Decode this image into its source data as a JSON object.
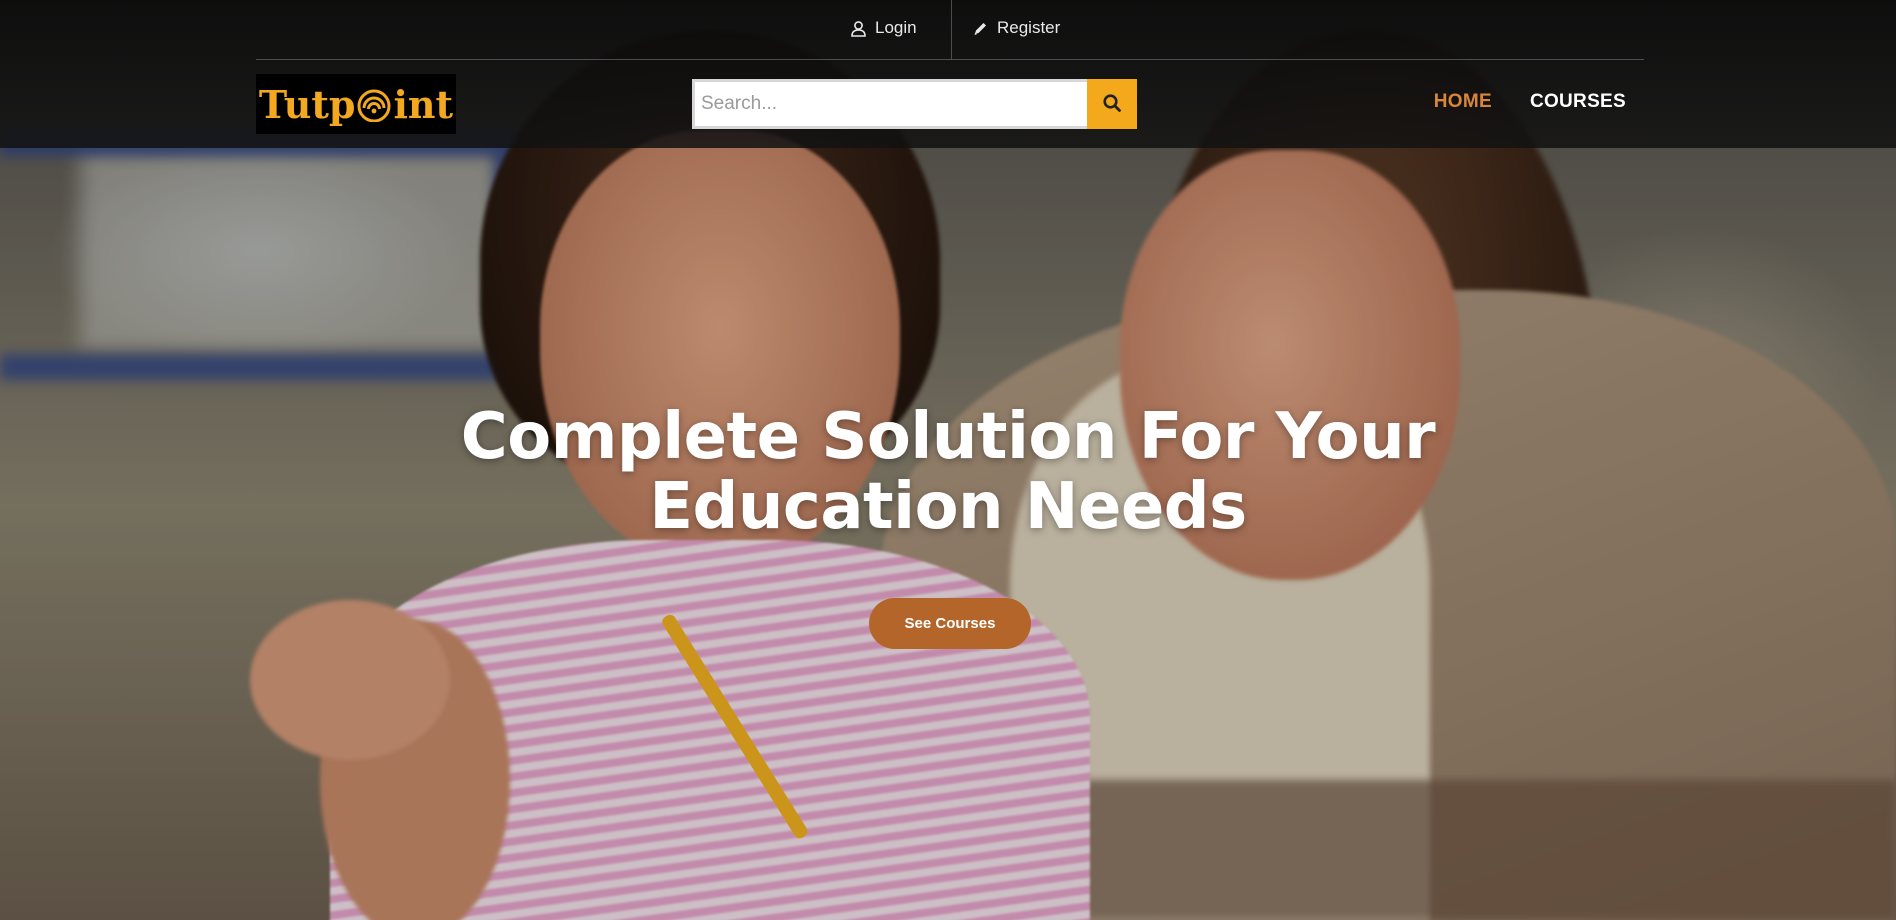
{
  "header": {
    "topbar": {
      "login_label": "Login",
      "login_icon": "user-icon",
      "register_label": "Register",
      "register_icon": "pencil-icon"
    },
    "logo": {
      "text_left": "Tutp",
      "text_right": "int",
      "alt_icon": "signal-o-icon"
    },
    "search": {
      "placeholder": "Search...",
      "value": "",
      "button_icon": "search-icon"
    },
    "nav": {
      "items": [
        {
          "label": "HOME",
          "active": true
        },
        {
          "label": "COURSES",
          "active": false
        }
      ]
    }
  },
  "hero": {
    "headline_line1": "Complete Solution For Your",
    "headline_line2": "Education Needs",
    "cta_label": "See Courses"
  },
  "colors": {
    "accent": "#f4a91d",
    "nav_active": "#d9863a",
    "cta": "#b4662a"
  }
}
